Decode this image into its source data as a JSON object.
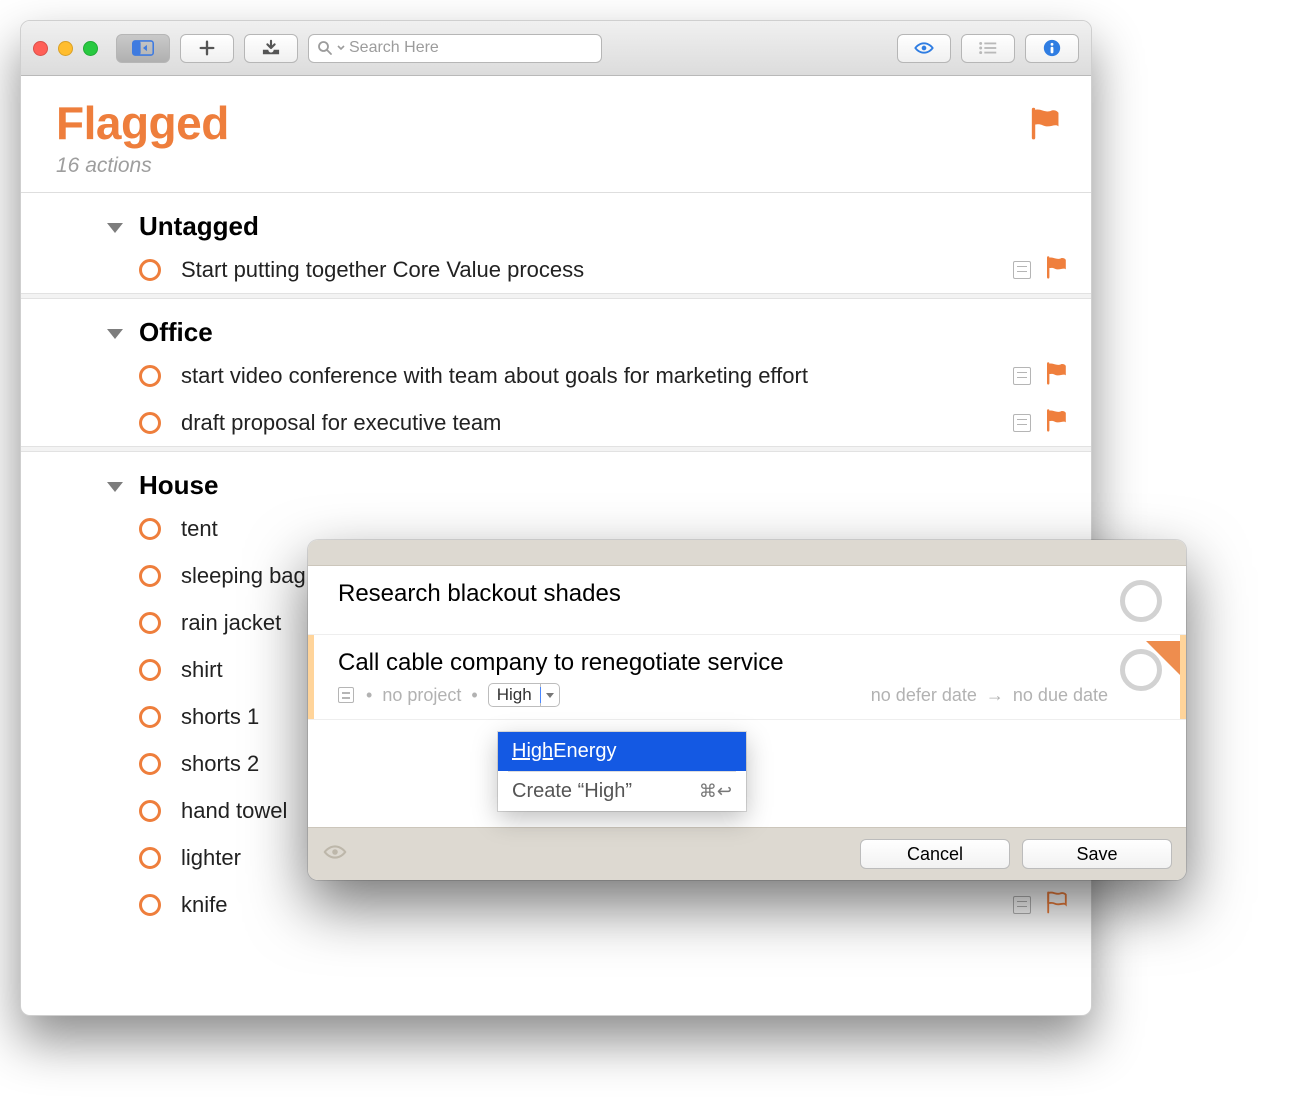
{
  "toolbar": {
    "search_placeholder": "Search Here"
  },
  "header": {
    "title": "Flagged",
    "subtitle": "16 actions"
  },
  "groups": [
    {
      "name": "Untagged",
      "items": [
        {
          "title": "Start putting together Core Value process",
          "note": true,
          "flag": "solid"
        }
      ]
    },
    {
      "name": "Office",
      "items": [
        {
          "title": "start video conference with team about goals for marketing effort",
          "note": true,
          "flag": "solid"
        },
        {
          "title": "draft proposal for executive team",
          "note": true,
          "flag": "solid"
        }
      ]
    },
    {
      "name": "House",
      "items": [
        {
          "title": "tent"
        },
        {
          "title": "sleeping bag"
        },
        {
          "title": "rain jacket"
        },
        {
          "title": "shirt"
        },
        {
          "title": "shorts 1"
        },
        {
          "title": "shorts 2"
        },
        {
          "title": "hand towel"
        },
        {
          "title": "lighter",
          "note": true,
          "flag": "outline"
        },
        {
          "title": "knife",
          "note": true,
          "flag": "outline"
        }
      ]
    }
  ],
  "panel": {
    "rows": [
      {
        "title": "Research blackout shades"
      },
      {
        "title": "Call cable company to renegotiate service",
        "project": "no project",
        "tag_input": "High",
        "defer": "no defer date",
        "due": "no due date"
      }
    ],
    "autocomplete": {
      "match_prefix": "High",
      "match_rest": " Energy",
      "create_label": "Create “High”",
      "create_shortcut": "⌘↩︎"
    },
    "buttons": {
      "cancel": "Cancel",
      "save": "Save"
    }
  }
}
